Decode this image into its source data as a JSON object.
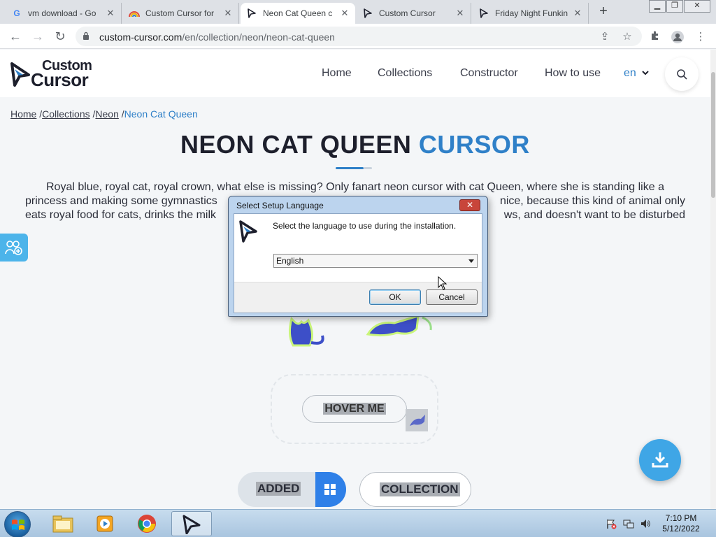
{
  "browser": {
    "tabs": [
      {
        "title": "vm download - Go",
        "favicon": "google-icon"
      },
      {
        "title": "Custom Cursor for",
        "favicon": "rainbow-icon"
      },
      {
        "title": "Neon Cat Queen c",
        "favicon": "cursor-icon"
      },
      {
        "title": "Custom Cursor",
        "favicon": "cursor-icon"
      },
      {
        "title": "Friday Night Funkin",
        "favicon": "cursor-icon"
      }
    ],
    "new_tab": "+",
    "url_host": "custom-cursor.com",
    "url_path": "/en/collection/neon/neon-cat-queen"
  },
  "site": {
    "logo_line1": "Custom",
    "logo_line2": "Cursor",
    "nav": [
      "Home",
      "Collections",
      "Constructor",
      "How to use"
    ],
    "lang": "en"
  },
  "breadcrumb": {
    "items": [
      "Home",
      "Collections",
      "Neon"
    ],
    "separator": "/",
    "current": "Neon Cat Queen"
  },
  "page": {
    "title_main": "NEON CAT QUEEN",
    "title_accent": "CURSOR",
    "desc_line1": "Royal blue, royal cat, royal crown, what else is missing? Only fanart neon cursor with cat Queen, where she is standing like a",
    "desc_line2a": "princess and making some gymnastics",
    "desc_line2b": "nice, because this kind of animal only",
    "desc_line3a": "eats royal food for cats, drinks the milk",
    "desc_line3b": "ws, and doesn't want to be disturbed",
    "hover_label": "HOVER ME",
    "added_label": "ADDED",
    "collection_label": "COLLECTION"
  },
  "dialog": {
    "title": "Select Setup Language",
    "close": "✕",
    "message": "Select the language to use during the installation.",
    "selected_language": "English",
    "ok": "OK",
    "cancel": "Cancel"
  },
  "taskbar": {
    "time": "7:10 PM",
    "date": "5/12/2022"
  },
  "colors": {
    "accent": "#2f80c8",
    "fab": "#3fa6e6",
    "windows_blue": "#2f80e8"
  }
}
